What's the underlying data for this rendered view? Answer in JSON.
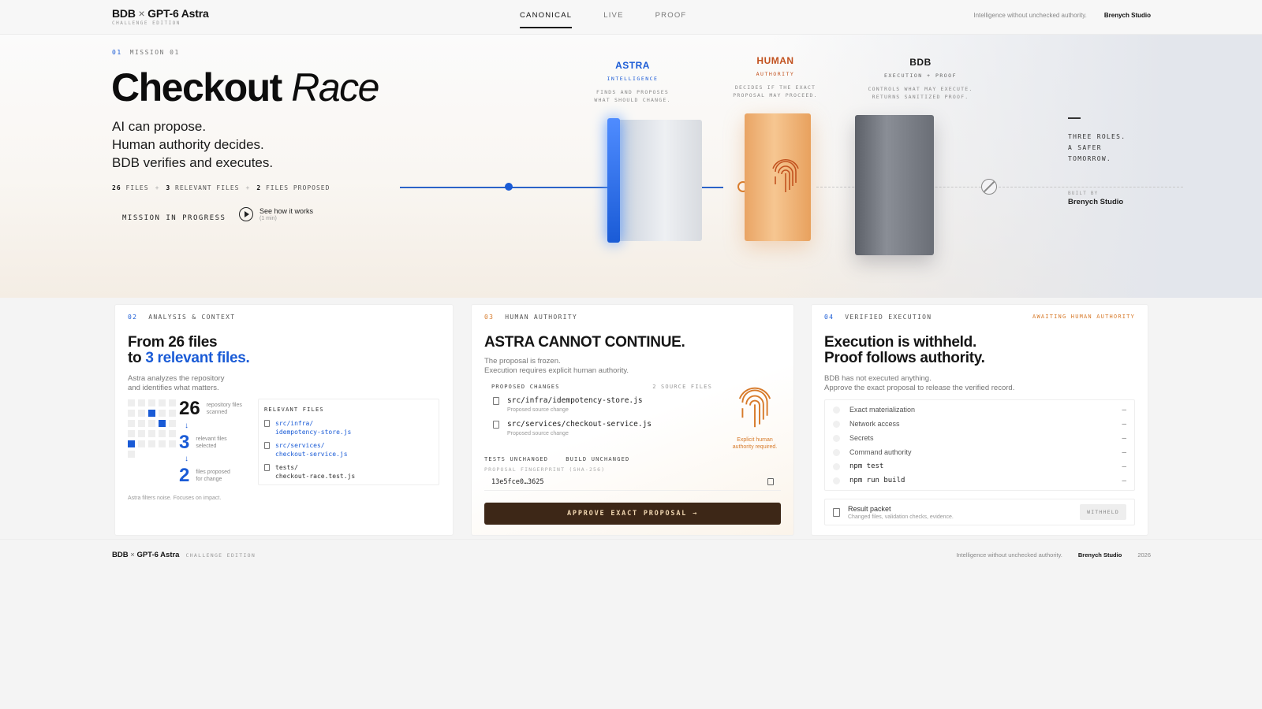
{
  "header": {
    "brand_left": "BDB",
    "brand_x": "×",
    "brand_right": "GPT-6 Astra",
    "edition": "CHALLENGE EDITION",
    "tabs": [
      "CANONICAL",
      "LIVE",
      "PROOF"
    ],
    "active_tab": "CANONICAL",
    "tagline": "Intelligence without unchecked authority.",
    "studio": "Brenych Studio"
  },
  "hero": {
    "kicker_num": "01",
    "kicker": "MISSION 01",
    "title_a": "Checkout",
    "title_b": "Race",
    "lines": [
      "AI can propose.",
      "Human authority decides.",
      "BDB verifies and executes."
    ],
    "stats": {
      "files_n": "26",
      "files": "FILES",
      "rel_n": "3",
      "rel": "RELEVANT FILES",
      "prop_n": "2",
      "prop": "FILES PROPOSED",
      "sep": "+"
    },
    "mission": "MISSION IN PROGRESS",
    "play_label": "See how it works",
    "play_sub": "(1 min)"
  },
  "roles": [
    {
      "name": "ASTRA",
      "sub": "INTELLIGENCE",
      "desc1": "FINDS AND PROPOSES",
      "desc2": "WHAT SHOULD CHANGE."
    },
    {
      "name": "HUMAN",
      "sub": "AUTHORITY",
      "desc1": "DECIDES IF THE EXACT",
      "desc2": "PROPOSAL MAY PROCEED."
    },
    {
      "name": "BDB",
      "sub": "EXECUTION + PROOF",
      "desc1": "CONTROLS WHAT MAY EXECUTE.",
      "desc2": "RETURNS SANITIZED PROOF."
    }
  ],
  "side": {
    "lines": [
      "THREE ROLES.",
      "A SAFER",
      "TOMORROW."
    ],
    "built_by": "BUILT BY",
    "studio": "Brenych Studio"
  },
  "colors": {
    "blue": "#1a5bd6",
    "orange": "#d77a2a",
    "dark_button": "#3d2717"
  },
  "card1": {
    "num": "02",
    "kicker": "ANALYSIS & CONTEXT",
    "h1": "From 26 files",
    "h2a": "to ",
    "h2b": "3 relevant files.",
    "p1": "Astra analyzes the repository",
    "p2": "and identifies what matters.",
    "s1": {
      "n": "26",
      "l1": "repository files",
      "l2": "scanned"
    },
    "s2": {
      "n": "3",
      "l1": "relevant files",
      "l2": "selected"
    },
    "s3": {
      "n": "2",
      "l1": "files proposed",
      "l2": "for change"
    },
    "arrow": "↓",
    "note": "Astra filters noise. Focuses on impact.",
    "rel_title": "RELEVANT FILES",
    "rel": [
      {
        "a": "src/infra/",
        "b": "idempotency-store.js"
      },
      {
        "a": "src/services/",
        "b": "checkout-service.js"
      },
      {
        "a": "tests/",
        "b": "checkout-race.test.js"
      }
    ]
  },
  "card2": {
    "num": "03",
    "kicker": "HUMAN AUTHORITY",
    "h": "ASTRA CANNOT CONTINUE.",
    "p1": "The proposal is frozen.",
    "p2": "Execution requires explicit human authority.",
    "pc_title": "PROPOSED CHANGES",
    "pc_count": "2 SOURCE FILES",
    "files": [
      {
        "path": "src/infra/idempotency-store.js",
        "sub": "Proposed source change"
      },
      {
        "path": "src/services/checkout-service.js",
        "sub": "Proposed source change"
      }
    ],
    "fp1": "Explicit human",
    "fp2": "authority required.",
    "tests": "TESTS UNCHANGED",
    "build": "BUILD UNCHANGED",
    "fp_label": "PROPOSAL FINGERPRINT (SHA-256)",
    "fp_value": "13e5fce0…3625",
    "approve": "APPROVE EXACT PROPOSAL →"
  },
  "card3": {
    "num": "04",
    "kicker": "VERIFIED EXECUTION",
    "status": "AWAITING HUMAN AUTHORITY",
    "h1": "Execution is withheld.",
    "h2": "Proof follows authority.",
    "p1": "BDB has not executed anything.",
    "p2": "Approve the exact proposal to release the verified record.",
    "checks": [
      "Exact materialization",
      "Network access",
      "Secrets",
      "Command authority",
      "npm test",
      "npm run build"
    ],
    "dash": "–",
    "result": "Result packet",
    "result_sub": "Changed files, validation checks, evidence.",
    "withheld": "WITHHELD"
  },
  "footer": {
    "brand_left": "BDB",
    "brand_x": "×",
    "brand_right": "GPT-6 Astra",
    "edition": "CHALLENGE EDITION",
    "tagline": "Intelligence without unchecked authority.",
    "studio": "Brenych Studio",
    "year": "2026"
  }
}
